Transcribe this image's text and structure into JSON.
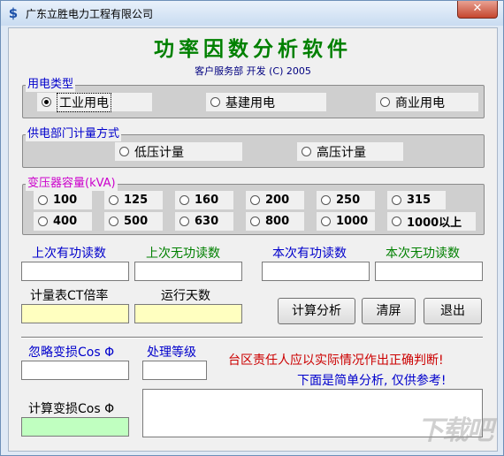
{
  "window": {
    "title": "广东立胜电力工程有限公司",
    "close_glyph": "✕",
    "icon_glyph": "$"
  },
  "header": {
    "title": "功率因数分析软件",
    "subtitle": "客户服务部 开发 (C) 2005"
  },
  "usage_type": {
    "legend": "用电类型",
    "options": [
      {
        "label": "工业用电",
        "selected": true
      },
      {
        "label": "基建用电",
        "selected": false
      },
      {
        "label": "商业用电",
        "selected": false
      }
    ]
  },
  "metering": {
    "legend": "供电部门计量方式",
    "options": [
      {
        "label": "低压计量",
        "selected": false
      },
      {
        "label": "高压计量",
        "selected": false
      }
    ]
  },
  "transformer": {
    "legend": "变压器容量(kVA)",
    "options": [
      "100",
      "125",
      "160",
      "200",
      "250",
      "315",
      "400",
      "500",
      "630",
      "800",
      "1000",
      "1000以上"
    ]
  },
  "readings": {
    "prev_active_label": "上次有功读数",
    "prev_reactive_label": "上次无功读数",
    "curr_active_label": "本次有功读数",
    "curr_reactive_label": "本次无功读数",
    "ct_ratio_label": "计量表CT倍率",
    "run_days_label": "运行天数"
  },
  "buttons": {
    "calculate": "计算分析",
    "clear": "清屏",
    "exit": "退出"
  },
  "analysis": {
    "ignore_cos_label": "忽略变损Cos Φ",
    "level_label": "处理等级",
    "calc_cos_label": "计算变损Cos Φ",
    "warning": "台区责任人应以实际情况作出正确判断!",
    "note": "下面是简单分析, 仅供参考!"
  },
  "watermark": "下载吧"
}
